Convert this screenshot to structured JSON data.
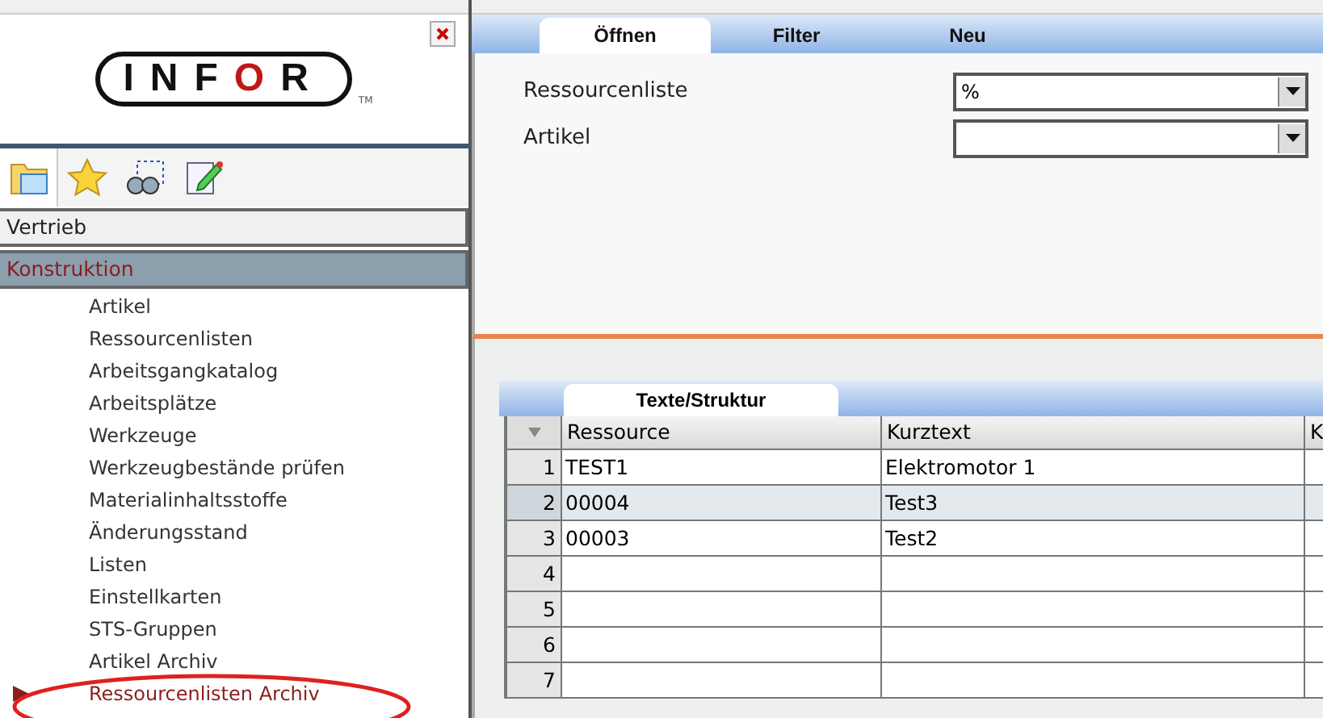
{
  "logo": {
    "before": "INF",
    "accent": "O",
    "after": "R",
    "trademark": "TM"
  },
  "toolbar": [
    {
      "kind": "folder",
      "selected": true
    },
    {
      "kind": "star",
      "selected": false
    },
    {
      "kind": "binoculars",
      "selected": false
    },
    {
      "kind": "notepad",
      "selected": false
    }
  ],
  "sections": [
    {
      "label": "Vertrieb",
      "selected": false
    },
    {
      "label": "Konstruktion",
      "selected": true,
      "items": [
        {
          "label": "Artikel",
          "selected": false
        },
        {
          "label": "Ressourcenlisten",
          "selected": false
        },
        {
          "label": "Arbeitsgangkatalog",
          "selected": false
        },
        {
          "label": "Arbeitsplätze",
          "selected": false
        },
        {
          "label": "Werkzeuge",
          "selected": false
        },
        {
          "label": "Werkzeugbestände prüfen",
          "selected": false
        },
        {
          "label": "Materialinhaltsstoffe",
          "selected": false
        },
        {
          "label": "Änderungsstand",
          "selected": false
        },
        {
          "label": "Listen",
          "selected": false
        },
        {
          "label": "Einstellkarten",
          "selected": false
        },
        {
          "label": "STS-Gruppen",
          "selected": false
        },
        {
          "label": "Artikel Archiv",
          "selected": false
        },
        {
          "label": "Ressourcenlisten Archiv",
          "selected": true
        }
      ]
    }
  ],
  "tabs": [
    {
      "label": "Öffnen",
      "selected": true
    },
    {
      "label": "Filter",
      "selected": false
    },
    {
      "label": "Neu",
      "selected": false
    }
  ],
  "fields": [
    {
      "label": "Ressourcenliste",
      "value": "%"
    },
    {
      "label": "Artikel"
    }
  ],
  "subtabs": [
    {
      "label": "Texte/Struktur",
      "selected": true
    }
  ],
  "table": {
    "columns": [
      "Ressource",
      "Kurztext",
      "K"
    ],
    "rows": [
      {
        "number": "1",
        "selected": false,
        "cells": [
          "TEST1",
          "Elektromotor 1"
        ]
      },
      {
        "number": "2",
        "selected": true,
        "cells": [
          "00004",
          "Test3"
        ]
      },
      {
        "number": "3",
        "selected": false,
        "cells": [
          "00003",
          "Test2"
        ]
      },
      {
        "number": "4",
        "selected": false
      },
      {
        "number": "5",
        "selected": false
      },
      {
        "number": "6",
        "selected": false
      },
      {
        "number": "7",
        "selected": false
      }
    ]
  }
}
